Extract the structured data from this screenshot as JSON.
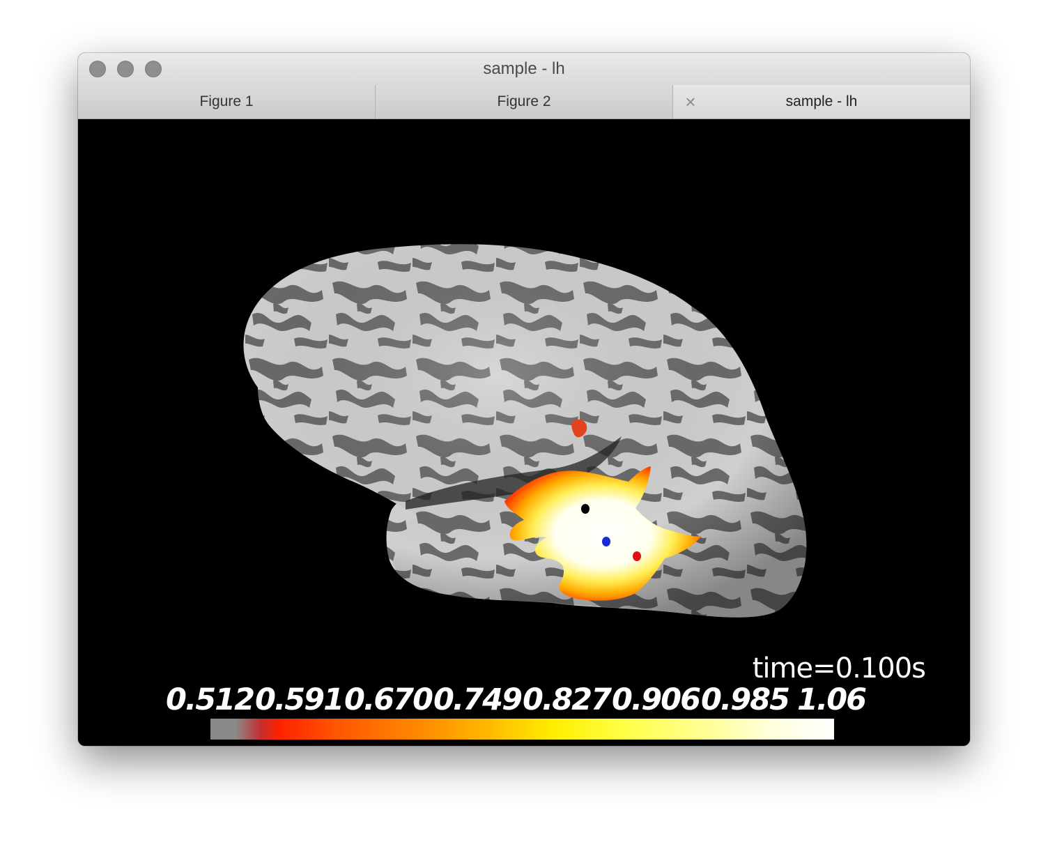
{
  "window": {
    "title": "sample - lh",
    "traffic_color": "#8e8e8e"
  },
  "tabs": [
    {
      "label": "Figure 1",
      "active": false
    },
    {
      "label": "Figure 2",
      "active": false
    },
    {
      "label": "sample - lh",
      "active": true,
      "close_icon": "close-icon"
    }
  ],
  "viewer": {
    "background": "#000000",
    "time_label": "time=0.100s",
    "colorbar": {
      "ticks": [
        "0.512",
        "0.591",
        "0.670",
        "0.749",
        "0.827",
        "0.906",
        "0.985",
        "1.06"
      ],
      "colormap": "hot"
    },
    "markers": [
      {
        "color": "#000000"
      },
      {
        "color": "#1a2bd6"
      },
      {
        "color": "#e01010"
      }
    ]
  }
}
